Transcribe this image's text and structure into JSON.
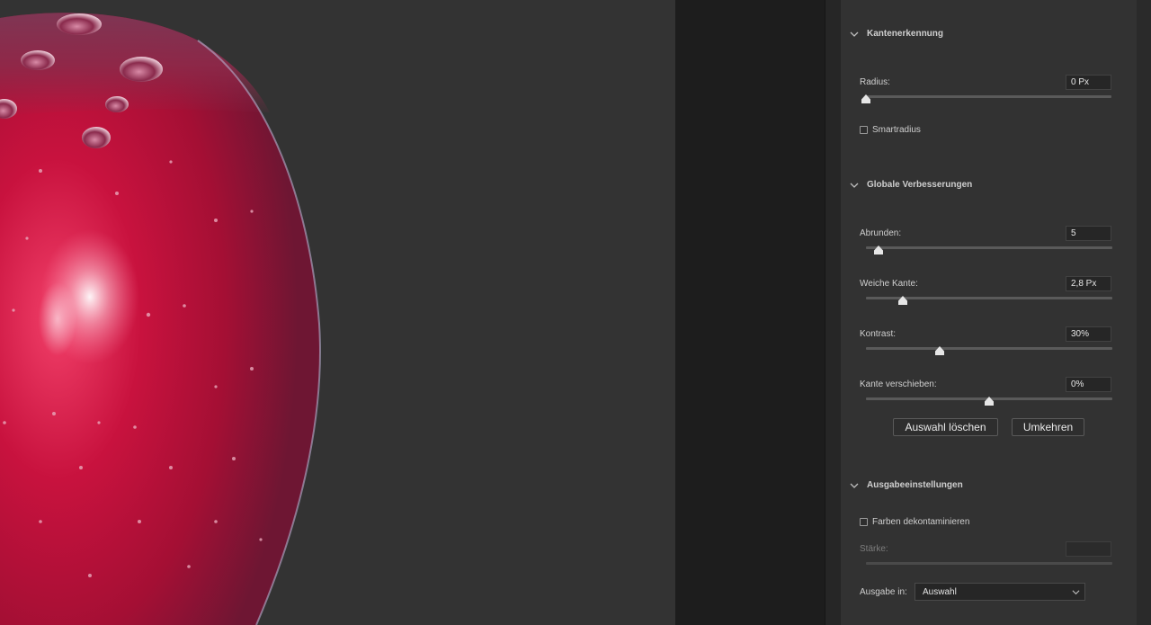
{
  "sections": {
    "edge_detection": {
      "title": "Kantenerkennung"
    },
    "global_refinements": {
      "title": "Globale Verbesserungen"
    },
    "output_settings": {
      "title": "Ausgabeeinstellungen"
    }
  },
  "edge_detection": {
    "radius": {
      "label": "Radius:",
      "value": "0 Px",
      "slider": 0.0
    },
    "smart_radius": {
      "label": "Smartradius",
      "checked": false
    }
  },
  "global_refinements": {
    "smooth": {
      "label": "Abrunden:",
      "value": "5",
      "slider": 0.05
    },
    "feather": {
      "label": "Weiche Kante:",
      "value": "2,8 Px",
      "slider": 0.15
    },
    "contrast": {
      "label": "Kontrast:",
      "value": "30%",
      "slider": 0.3
    },
    "shift_edge": {
      "label": "Kante verschieben:",
      "value": "0%",
      "slider": 0.5
    },
    "clear_selection_button": "Auswahl löschen",
    "invert_button": "Umkehren"
  },
  "output_settings": {
    "decontaminate": {
      "label": "Farben dekontaminieren",
      "checked": false
    },
    "amount": {
      "label": "Stärke:",
      "value": ""
    },
    "output_to": {
      "label": "Ausgabe in:",
      "selected": "Auswahl"
    }
  },
  "icons": {
    "section_toggle": "chevron-down-icon",
    "select_caret": "chevron-down-icon"
  },
  "colors": {
    "canvas_bg": "#333333",
    "panel_bg": "#323232",
    "apple_red": "#c0123a"
  }
}
